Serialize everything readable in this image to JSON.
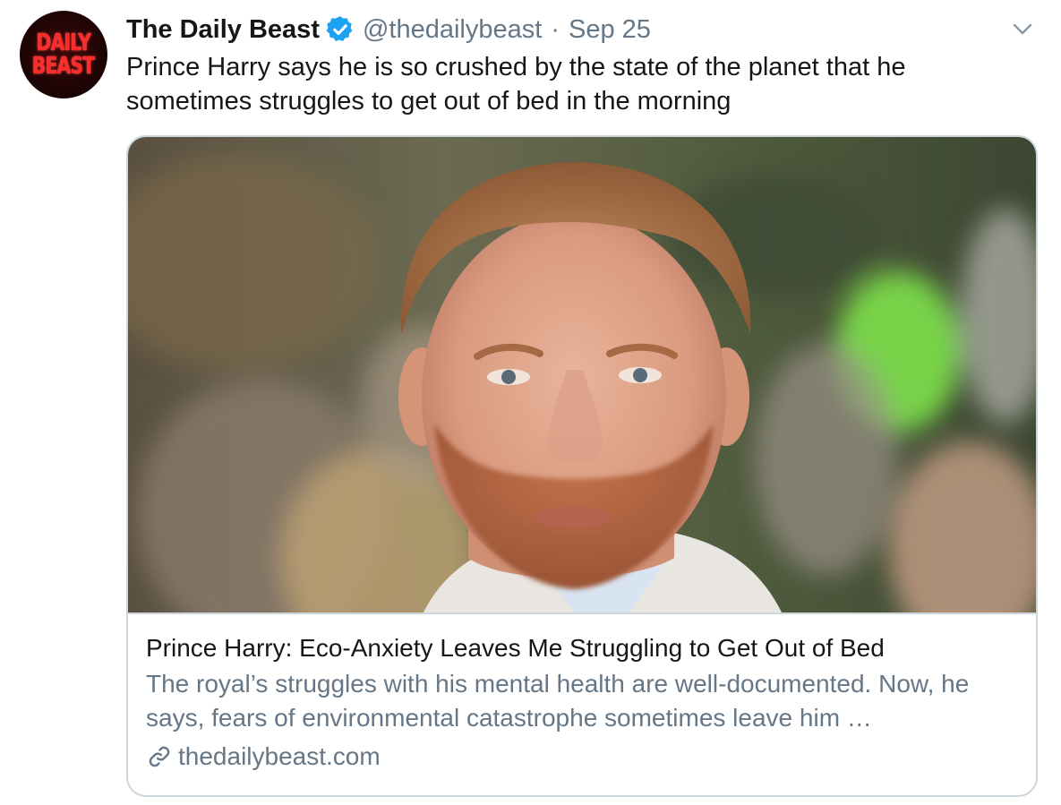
{
  "tweet": {
    "display_name": "The Daily Beast",
    "handle": "@thedailybeast",
    "separator": "·",
    "date": "Sep 25",
    "text": "Prince Harry says he is so crushed by the state of the planet that he sometimes struggles to get out of bed in the morning",
    "avatar_logo_lines": [
      "DAILY",
      "BEAST"
    ],
    "icons": {
      "verified": "verified-badge-icon",
      "menu": "chevron-down-icon",
      "link": "link-icon"
    }
  },
  "card": {
    "image_subject": "photo-of-prince-harry",
    "title": "Prince Harry: Eco-Anxiety Leaves Me Struggling to Get Out of Bed",
    "description": "The royal’s struggles with his mental health are well-documented. Now, he says, fears of environmental catastrophe sometimes leave him …",
    "domain": "thedailybeast.com"
  },
  "colors": {
    "text_primary": "#14171a",
    "text_secondary": "#657786",
    "verified_blue": "#1da1f2",
    "card_border": "#ccd6dd",
    "logo_red": "#ff2a2a"
  }
}
